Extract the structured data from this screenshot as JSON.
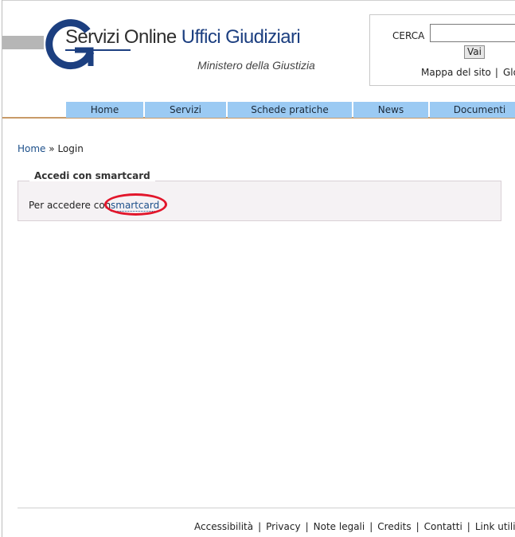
{
  "header": {
    "title_part1": "Servizi Online",
    "title_part2": "Uffici Giudiziari",
    "subtitle": "Ministero della Giustizia",
    "logo_icon": "g-logo",
    "colors": {
      "brand_blue": "#1c3f80",
      "nav_bg": "#9bcaf3",
      "nav_rule": "#c89a68",
      "highlight": "#e2162b"
    }
  },
  "search": {
    "label": "CERCA",
    "value": "",
    "placeholder": "",
    "button_label": "Vai",
    "links": [
      "Mappa del sito",
      "Glo"
    ]
  },
  "nav": {
    "items": [
      "Home",
      "Servizi",
      "Schede pratiche",
      "News",
      "Documenti"
    ]
  },
  "breadcrumb": {
    "home": "Home",
    "separator": "»",
    "current": "Login"
  },
  "login_panel": {
    "legend": "Accedi con smartcard",
    "text": "Per accedere con",
    "link_label": "smartcard"
  },
  "footer": {
    "links": [
      "Accessibilità",
      "Privacy",
      "Note legali",
      "Credits",
      "Contatti",
      "Link utili"
    ],
    "separator": "|"
  }
}
